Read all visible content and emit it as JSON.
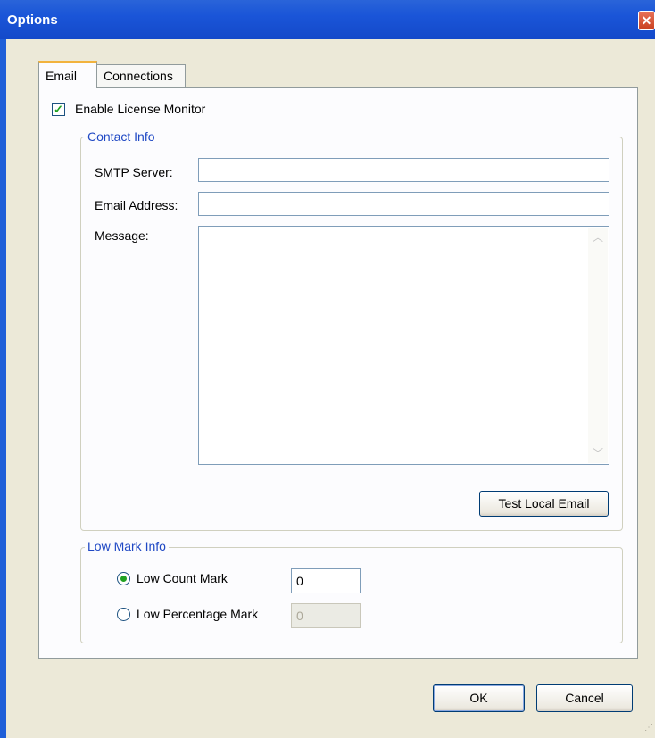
{
  "window": {
    "title": "Options",
    "close_glyph": "✕"
  },
  "tabs": [
    {
      "label": "Email",
      "selected": true
    },
    {
      "label": "Connections",
      "selected": false
    }
  ],
  "enable_monitor": {
    "label": "Enable License Monitor",
    "checked": true
  },
  "contact_info": {
    "legend": "Contact Info",
    "smtp_label": "SMTP Server:",
    "smtp_value": "",
    "email_label": "Email Address:",
    "email_value": "",
    "message_label": "Message:",
    "message_value": "",
    "test_button": "Test Local Email"
  },
  "low_mark_info": {
    "legend": "Low Mark Info",
    "count_label": "Low Count Mark",
    "count_value": "0",
    "count_selected": true,
    "percentage_label": "Low Percentage Mark",
    "percentage_value": "0",
    "percentage_selected": false
  },
  "buttons": {
    "ok": "OK",
    "cancel": "Cancel"
  },
  "icons": {
    "checkmark": "check-icon",
    "scroll_up": "chevron-up-icon",
    "scroll_down": "chevron-down-icon"
  },
  "colors": {
    "title_bar": "#1a55d8",
    "legend_text": "#1f48c4",
    "check": "#21a121"
  }
}
